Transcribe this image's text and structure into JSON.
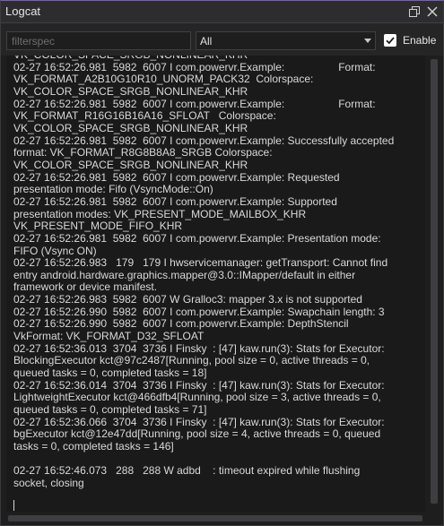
{
  "window": {
    "title": "Logcat",
    "accent_color": "#7a5cc6"
  },
  "titlebar": {
    "restore_icon": "restore-window-icon",
    "close_icon": "close-icon"
  },
  "toolbar": {
    "filter_placeholder": "filterspec",
    "filter_value": "",
    "level_select_value": "All",
    "enable_checked": true,
    "enable_label": "Enable"
  },
  "log": {
    "text": "VK_COLOR_SPACE_SRGB_NONLINEAR_KHR\n02-27 16:52:26.981  5982  6007 I com.powervr.Example:                  Format:\nVK_FORMAT_A2B10G10R10_UNORM_PACK32  Colorspace:\nVK_COLOR_SPACE_SRGB_NONLINEAR_KHR\n02-27 16:52:26.981  5982  6007 I com.powervr.Example:                  Format:\nVK_FORMAT_R16G16B16A16_SFLOAT   Colorspace:\nVK_COLOR_SPACE_SRGB_NONLINEAR_KHR\n02-27 16:52:26.981  5982  6007 I com.powervr.Example: Successfully accepted\nformat: VK_FORMAT_R8G8B8A8_SRGB Colorspace:\nVK_COLOR_SPACE_SRGB_NONLINEAR_KHR\n02-27 16:52:26.981  5982  6007 I com.powervr.Example: Requested\npresentation mode: Fifo (VsyncMode::On)\n02-27 16:52:26.981  5982  6007 I com.powervr.Example: Supported\npresentation modes: VK_PRESENT_MODE_MAILBOX_KHR\nVK_PRESENT_MODE_FIFO_KHR\n02-27 16:52:26.981  5982  6007 I com.powervr.Example: Presentation mode:\nFIFO (Vsync ON)\n02-27 16:52:26.983   179   179 I hwservicemanager: getTransport: Cannot find\nentry android.hardware.graphics.mapper@3.0::IMapper/default in either\nframework or device manifest.\n02-27 16:52:26.983  5982  6007 W Gralloc3: mapper 3.x is not supported\n02-27 16:52:26.990  5982  6007 I com.powervr.Example: Swapchain length: 3\n02-27 16:52:26.990  5982  6007 I com.powervr.Example: DepthStencil\nVkFormat: VK_FORMAT_D32_SFLOAT\n02-27 16:52:36.013  3704  3736 I Finsky  : [47] kaw.run(3): Stats for Executor:\nBlockingExecutor kct@97c2487[Running, pool size = 0, active threads = 0,\nqueued tasks = 0, completed tasks = 18]\n02-27 16:52:36.014  3704  3736 I Finsky  : [47] kaw.run(3): Stats for Executor:\nLightweightExecutor kct@466dfb4[Running, pool size = 3, active threads = 0,\nqueued tasks = 0, completed tasks = 71]\n02-27 16:52:36.066  3704  3736 I Finsky  : [47] kaw.run(3): Stats for Executor:\nbgExecutor kct@12e47dd[Running, pool size = 4, active threads = 0, queued\ntasks = 0, completed tasks = 146]\n\n02-27 16:52:46.073   288   288 W adbd    : timeout expired while flushing\nsocket, closing"
  }
}
